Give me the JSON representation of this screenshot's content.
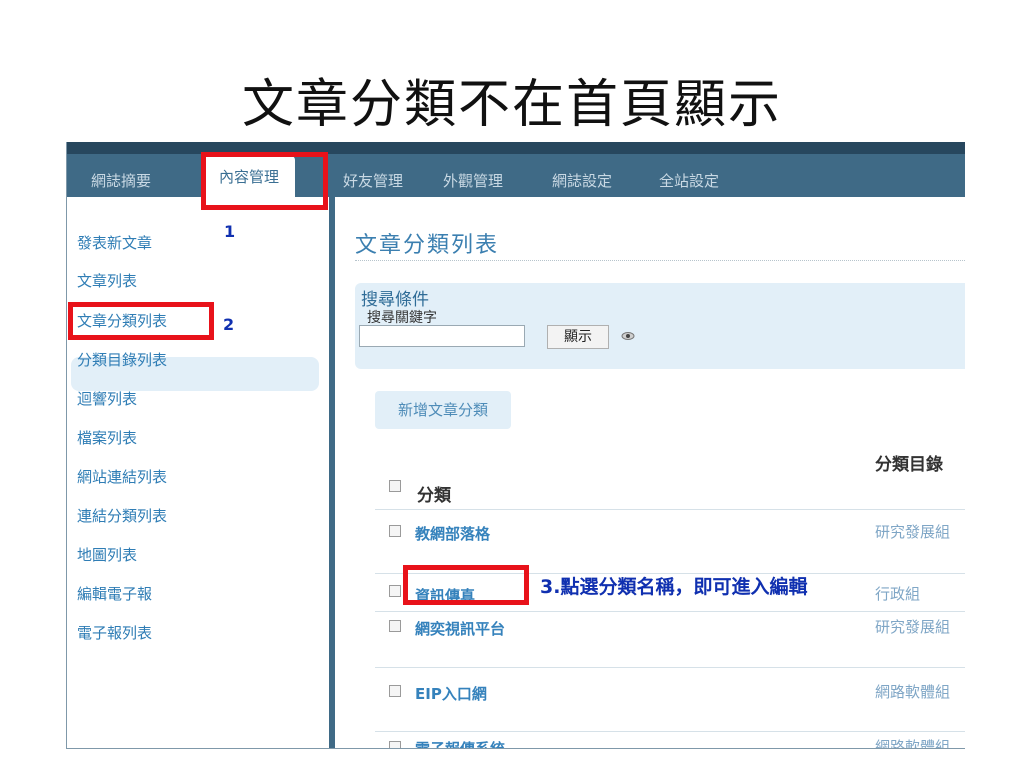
{
  "slide_title": "文章分類不在首頁顯示",
  "top_tabs": [
    {
      "label": "網誌摘要"
    },
    {
      "label": "內容管理"
    },
    {
      "label": "好友管理"
    },
    {
      "label": "外觀管理"
    },
    {
      "label": "網誌設定"
    },
    {
      "label": "全站設定"
    }
  ],
  "sidebar": {
    "items": [
      {
        "label": "發表新文章"
      },
      {
        "label": "文章列表"
      },
      {
        "label": "文章分類列表"
      },
      {
        "label": "分類目錄列表"
      },
      {
        "label": "迴響列表"
      },
      {
        "label": "檔案列表"
      },
      {
        "label": "網站連結列表"
      },
      {
        "label": "連結分類列表"
      },
      {
        "label": "地圖列表"
      },
      {
        "label": "編輯電子報"
      },
      {
        "label": "電子報列表"
      }
    ]
  },
  "main": {
    "page_title": "文章分類列表",
    "search": {
      "legend": "搜尋條件",
      "keyword_label": "搜尋關鍵字",
      "keyword_value": "",
      "show_button": "顯示"
    },
    "add_button": "新增文章分類",
    "table": {
      "headers": {
        "category": "分類",
        "directory": "分類目錄"
      },
      "rows": [
        {
          "category": "教網部落格",
          "directory": "研究發展組"
        },
        {
          "category": "資訊傳真",
          "directory": "行政組"
        },
        {
          "category": "網奕視訊平台",
          "directory": "研究發展組"
        },
        {
          "category": "EIP入口網",
          "directory": "網路軟體組"
        },
        {
          "category": "電子報傳系統",
          "directory": "網路軟體組"
        }
      ]
    }
  },
  "annotations": {
    "step1": "1",
    "step2": "2",
    "step3": "3.點選分類名稱，即可進入編輯"
  },
  "colors": {
    "header_bg": "#3f6a86",
    "link": "#2f7db5",
    "highlight_bg": "#e2eff8",
    "annotation_box": "#e8121a",
    "annotation_text": "#1030b0"
  }
}
